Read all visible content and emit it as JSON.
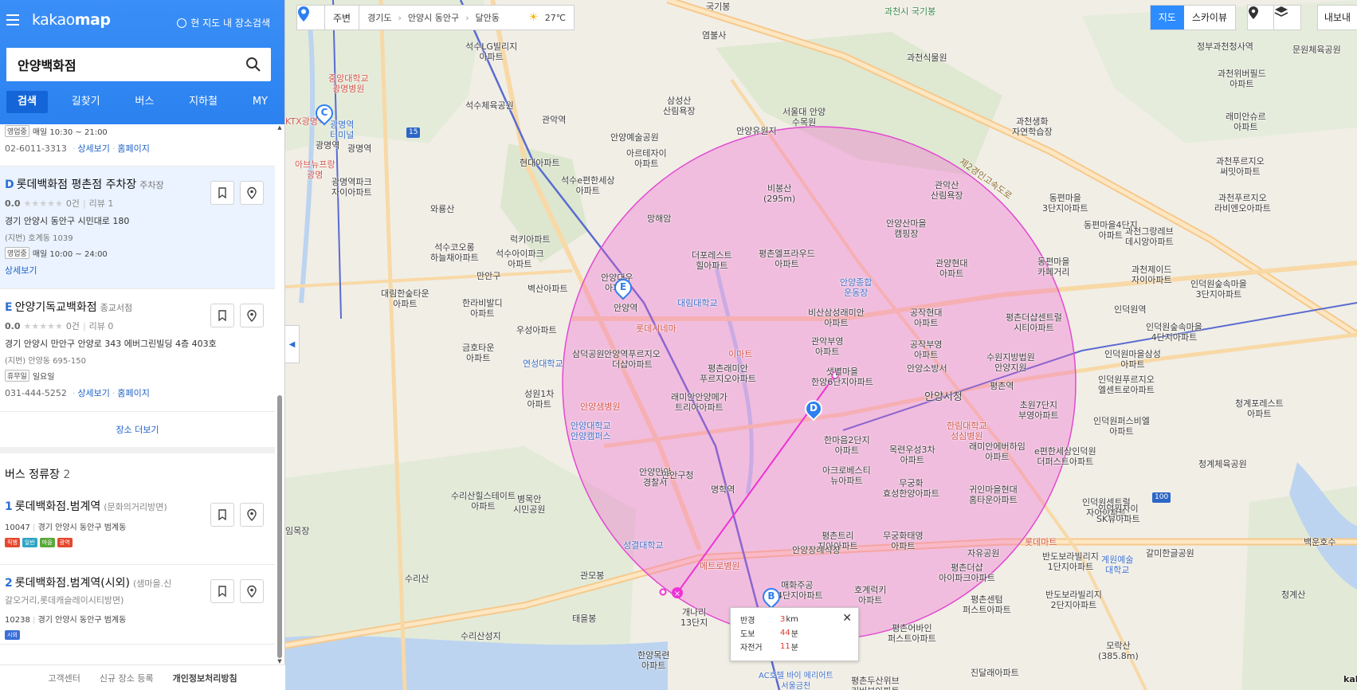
{
  "app": {
    "logo_prefix": "kakao",
    "logo_bold": "map",
    "map_search_toggle": "현 지도 내 장소검색"
  },
  "search": {
    "value": "안양백화점",
    "placeholder": "장소, 주소, 버스 검색"
  },
  "tabs": [
    {
      "label": "검색",
      "active": true
    },
    {
      "label": "길찾기",
      "active": false
    },
    {
      "label": "버스",
      "active": false
    },
    {
      "label": "지하철",
      "active": false
    },
    {
      "label": "MY",
      "active": false
    }
  ],
  "partial_item": {
    "hours_badge": "영업중",
    "hours": "매일 10:30 ~ 21:00",
    "phone": "02-6011-3313",
    "detail": "상세보기",
    "homepage": "홈페이지"
  },
  "places": [
    {
      "marker": "D",
      "name": "롯데백화점 평촌점 주차장",
      "category": "주차장",
      "score": "0.0",
      "stars": "★★★★★",
      "review_count": "0건",
      "reviews": "리뷰 1",
      "address": "경기 안양시 동안구 시민대로 180",
      "jibun": "(지번) 호계동 1039",
      "status": "영업중",
      "hours": "매일 10:00 ~ 24:00",
      "phone": "",
      "detail": "상세보기",
      "homepage": ""
    },
    {
      "marker": "E",
      "name": "안양기독교백화점",
      "category": "종교서점",
      "score": "0.0",
      "stars": "★★★★★",
      "review_count": "0건",
      "reviews": "리뷰 0",
      "address": "경기 안양시 만안구 안양로 343 에버그린빌딩 4층 403호",
      "jibun": "(지번) 안양동 695-150",
      "status": "휴무일",
      "hours": "일요일",
      "phone": "031-444-5252",
      "detail": "상세보기",
      "homepage": "홈페이지"
    }
  ],
  "more_places": "장소 더보기",
  "bus_section": {
    "title": "버스 정류장",
    "count": "2"
  },
  "bus_stops": [
    {
      "num": "1",
      "name": "롯데백화점.범계역",
      "direction": "(문화의거리방면)",
      "sub": "",
      "id": "10047",
      "address": "경기 안양시 동안구 범계동",
      "badges": [
        {
          "t": "직행",
          "c": "#e5482f"
        },
        {
          "t": "일반",
          "c": "#2fa4c4"
        },
        {
          "t": "마을",
          "c": "#5aa83a"
        },
        {
          "t": "광역",
          "c": "#e5482f"
        }
      ]
    },
    {
      "num": "2",
      "name": "롯데백화점.범계역(시외)",
      "direction": "(샘마을.신",
      "sub": "갈오거리,롯데캐슬레이시티방면)",
      "id": "10238",
      "address": "경기 안양시 동안구 범계동",
      "badges": [
        {
          "t": "시외",
          "c": "#3a6fd8"
        }
      ]
    }
  ],
  "footer": {
    "links": [
      "고객센터",
      "신규 장소 등록"
    ],
    "strong": "개인정보처리방침"
  },
  "map": {
    "top_bar": {
      "nearby": "주변",
      "crumbs": [
        "경기도",
        "안양시 동안구",
        "달안동"
      ],
      "weather": "27℃"
    },
    "map_types": [
      {
        "label": "지도",
        "active": true
      },
      {
        "label": "스카이뷰",
        "active": false
      }
    ],
    "export": "내보내",
    "labels": [
      {
        "t": "염불사"
      },
      {
        "t": "국기봉"
      },
      {
        "t": "과천시 국기봉"
      },
      {
        "t": "서울대 안양\n수목원"
      },
      {
        "t": "과천생화\n자연학습장"
      },
      {
        "t": "과천식물원"
      },
      {
        "t": "석수LG빌리지\n아파트"
      },
      {
        "t": "석수체육공원"
      },
      {
        "t": "관악역"
      },
      {
        "t": "안양예술공원"
      },
      {
        "t": "아르테자이\n아파트"
      },
      {
        "t": "현대아파트"
      },
      {
        "t": "석수e편한세상\n아파트"
      },
      {
        "t": "삼성산\n산림욕장"
      },
      {
        "t": "안양유원지"
      },
      {
        "t": "비봉산\n(295m)"
      },
      {
        "t": "관악산\n산림욕장"
      },
      {
        "t": "안양산마을\n캠핑장"
      },
      {
        "t": "망해암"
      },
      {
        "t": "더포레스트\n힐아파트"
      },
      {
        "t": "평촌엘프라우드\n아파트"
      },
      {
        "t": "관양현대\n아파트"
      },
      {
        "t": "동편마을\n3단지아파트"
      },
      {
        "t": "동편마을4단지\n아파트"
      },
      {
        "t": "동편마을\n카페거리"
      },
      {
        "t": "광명역파크\n자이아파트"
      },
      {
        "t": "광명역"
      },
      {
        "t": "와룡산"
      },
      {
        "t": "석수코오롱\n하늘채아파트"
      },
      {
        "t": "석수아이파크\n아파트"
      },
      {
        "t": "럭키아파트"
      },
      {
        "t": "만안구"
      },
      {
        "t": "벽산아파트"
      },
      {
        "t": "대림한숲타운\n아파트"
      },
      {
        "t": "한라비발디\n아파트"
      },
      {
        "t": "금호타운\n아파트"
      },
      {
        "t": "우성아파트"
      },
      {
        "t": "연성대학교"
      },
      {
        "t": "삼덕공원"
      },
      {
        "t": "성원1차\n아파트"
      },
      {
        "t": "안양대우\n아파트"
      },
      {
        "t": "안양역"
      },
      {
        "t": "롯데시네마"
      },
      {
        "t": "대림대학교"
      },
      {
        "t": "이마트"
      },
      {
        "t": "안양종합\n운동장"
      },
      {
        "t": "비산삼성래미안\n아파트"
      },
      {
        "t": "관악부영\n아파트"
      },
      {
        "t": "공작현대\n아파트"
      },
      {
        "t": "공작부영\n아파트"
      },
      {
        "t": "평촌더샵센트럴\n시티아파트"
      },
      {
        "t": "수원지방법원\n안양지원"
      },
      {
        "t": "안양소방서"
      },
      {
        "t": "샛별마을\n한양6단지아파트"
      },
      {
        "t": "평촌래미안\n푸르지오아파트"
      },
      {
        "t": "안양역푸르지오\n더샵아파트"
      },
      {
        "t": "래미안안양메가\n트리아아파트"
      },
      {
        "t": "안양샘병원"
      },
      {
        "t": "안양대학교\n안양캠퍼스"
      },
      {
        "t": "안양시청"
      },
      {
        "t": "평촌역"
      },
      {
        "t": "초원7단지\n부영아파트"
      },
      {
        "t": "한림대학교\n성심병원"
      },
      {
        "t": "한마음2단지\n아파트"
      },
      {
        "t": "목련우성3차\n아파트"
      },
      {
        "t": "래미안에버하임\n아파트"
      },
      {
        "t": "e편한세상인덕원\n더퍼스트아파트"
      },
      {
        "t": "인덕원퍼스비엘\n아파트"
      },
      {
        "t": "아크로베스티\n뉴아파트"
      },
      {
        "t": "무궁화\n효성한양아파트"
      },
      {
        "t": "귀인마을현대\n홈타운아파트"
      },
      {
        "t": "안양만안\n경찰서"
      },
      {
        "t": "만안구청"
      },
      {
        "t": "명학역"
      },
      {
        "t": "수리산힐스테이트\n아파트"
      },
      {
        "t": "병목안\n시민공원"
      },
      {
        "t": "성결대학교"
      },
      {
        "t": "평촌트리\n지아아파트"
      },
      {
        "t": "무궁화태영\n아파트"
      },
      {
        "t": "자유공원"
      },
      {
        "t": "평촌더샵\n아이파크아파트"
      },
      {
        "t": "인덕원센트럴\n자이아파트"
      },
      {
        "t": "인덕원자이\nSK뷰아파트"
      },
      {
        "t": "롯데마트"
      },
      {
        "t": "반도보라빌리지\n1단지아파트"
      },
      {
        "t": "반도보라빌리지\n2단지아파트"
      },
      {
        "t": "안양장례식장"
      },
      {
        "t": "메트로병원"
      },
      {
        "t": "매화주공\n14단지아파트"
      },
      {
        "t": "호계럭키\n아파트"
      },
      {
        "t": "평촌센텀\n퍼스트아파트"
      },
      {
        "t": "평촌어바인\n퍼스트아파트"
      },
      {
        "t": "관모봉"
      },
      {
        "t": "수리산성지"
      },
      {
        "t": "태을봉"
      },
      {
        "t": "한양목련\n아파트"
      },
      {
        "t": "개나리\n13단지"
      },
      {
        "t": "AC호텔 바이 메리어트\n서울금천"
      },
      {
        "t": "평촌두산위브\n리버뷰아파트"
      },
      {
        "t": "진달래아파트"
      },
      {
        "t": "모락산\n(385.8m)"
      },
      {
        "t": "계원예술\n대학교"
      },
      {
        "t": "갈미한글공원"
      },
      {
        "t": "청계체육공원"
      },
      {
        "t": "청계포레스트\n아파트"
      },
      {
        "t": "과천위버필드\n아파트"
      },
      {
        "t": "과천푸르지오\n써밋아파트"
      },
      {
        "t": "래미안슈르\n아파트"
      },
      {
        "t": "과천푸르지오\n라비엔오아파트"
      },
      {
        "t": "과천그랑레브\n데시앙아파트"
      },
      {
        "t": "과천제이드\n자이아파트"
      },
      {
        "t": "인덕원숲속마을\n3단지아파트"
      },
      {
        "t": "인덕원역"
      },
      {
        "t": "인덕원숲속마을\n4단지아파트"
      },
      {
        "t": "인덕원마을삼성\n아파트"
      },
      {
        "t": "인덕원푸르지오\n엘센트로아파트"
      },
      {
        "t": "정부과천청사역"
      },
      {
        "t": "문원체육공원"
      },
      {
        "t": "백운호수"
      },
      {
        "t": "청계산"
      },
      {
        "t": "수리산"
      },
      {
        "t": "임목장"
      },
      {
        "t": "중앙대학교\n광명병원"
      },
      {
        "t": "KTX광명역"
      },
      {
        "t": "광명역"
      },
      {
        "t": "광명역\n터미널"
      },
      {
        "t": "아브뉴프랑\n광명"
      }
    ],
    "popup": {
      "rows": [
        {
          "k": "반경",
          "v": "3",
          "u": "km"
        },
        {
          "k": "도보",
          "v": "44",
          "u": "분"
        },
        {
          "k": "자전거",
          "v": "11",
          "u": "분"
        }
      ],
      "close": "✕"
    },
    "pins": [
      {
        "t": "D"
      },
      {
        "t": "E"
      },
      {
        "t": "C"
      },
      {
        "t": "B"
      }
    ],
    "highway": "제2경인고속도로",
    "road_num": "15",
    "road_num2": "100",
    "copyright": "kaka"
  }
}
